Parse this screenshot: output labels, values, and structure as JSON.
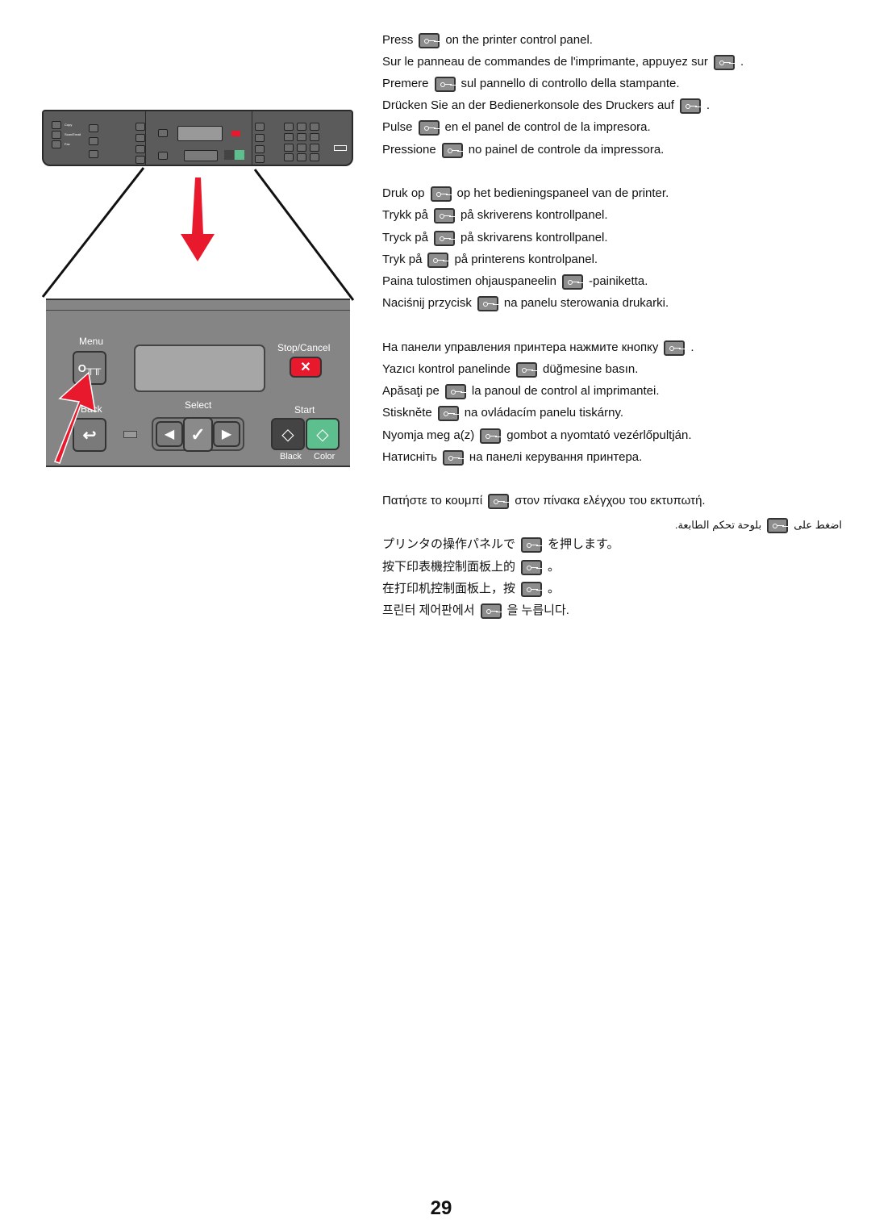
{
  "illustration": {
    "top_panel_labels": {
      "copy": "Copy",
      "scan": "Scan/Email",
      "fax": "Fax"
    },
    "labels": {
      "menu": "Menu",
      "stop_cancel": "Stop/Cancel",
      "back": "Back",
      "select": "Select",
      "start": "Start",
      "black": "Black",
      "color": "Color"
    },
    "colors": {
      "panel": "#858585",
      "arrow": "#e8192c",
      "cancel": "#e8192c",
      "start_black": "#444444",
      "start_color": "#5cbf8d"
    },
    "icons": [
      "key-icon",
      "close-icon",
      "back-icon",
      "left-arrow-icon",
      "checkmark-icon",
      "right-arrow-icon",
      "start-diamond-icon"
    ]
  },
  "groups": [
    [
      {
        "before": "Press",
        "after": "on the printer control panel."
      },
      {
        "before": "Sur le panneau de commandes de l'imprimante, appuyez sur",
        "after": "."
      },
      {
        "before": "Premere",
        "after": "sul pannello di controllo della stampante."
      },
      {
        "before": "Drücken Sie an der Bedienerkonsole des Druckers auf",
        "after": "."
      },
      {
        "before": "Pulse",
        "after": "en el panel de control de la impresora."
      },
      {
        "before": "Pressione",
        "after": "no painel de controle da impressora."
      }
    ],
    [
      {
        "before": "Druk op",
        "after": "op het bedieningspaneel van de printer."
      },
      {
        "before": "Trykk på",
        "after": "på skriverens kontrollpanel."
      },
      {
        "before": "Tryck på",
        "after": "på skrivarens kontrollpanel."
      },
      {
        "before": "Tryk på",
        "after": "på printerens kontrolpanel."
      },
      {
        "before": "Paina tulostimen ohjauspaneelin",
        "after": "-painiketta."
      },
      {
        "before": "Naciśnij przycisk",
        "after": "na panelu sterowania drukarki."
      }
    ],
    [
      {
        "before": "На панели управления принтера нажмите кнопку",
        "after": "."
      },
      {
        "before": "Yazıcı kontrol panelinde",
        "after": "düğmesine basın."
      },
      {
        "before": "Apăsaţi pe",
        "after": "la panoul de control al imprimantei."
      },
      {
        "before": "Stiskněte",
        "after": "na ovládacím panelu tiskárny."
      },
      {
        "before": "Nyomja meg a(z)",
        "after": "gombot a nyomtató vezérlőpultján."
      },
      {
        "before": "Натисніть",
        "after": "на панелі керування принтера."
      }
    ],
    [
      {
        "before": "Πατήστε το κουμπί",
        "after": "στον πίνακα ελέγχου του εκτυπωτή."
      },
      {
        "before": "اضغط على",
        "after": "بلوحة تحكم الطابعة."
      },
      {
        "before": "プリンタの操作パネルで",
        "after": "を押します。"
      },
      {
        "before": "按下印表機控制面板上的",
        "after": "。"
      },
      {
        "before": "在打印机控制面板上，按",
        "after": "。"
      },
      {
        "before": "프린터 제어판에서",
        "after": "을 누릅니다."
      }
    ]
  ],
  "page_number": "29"
}
